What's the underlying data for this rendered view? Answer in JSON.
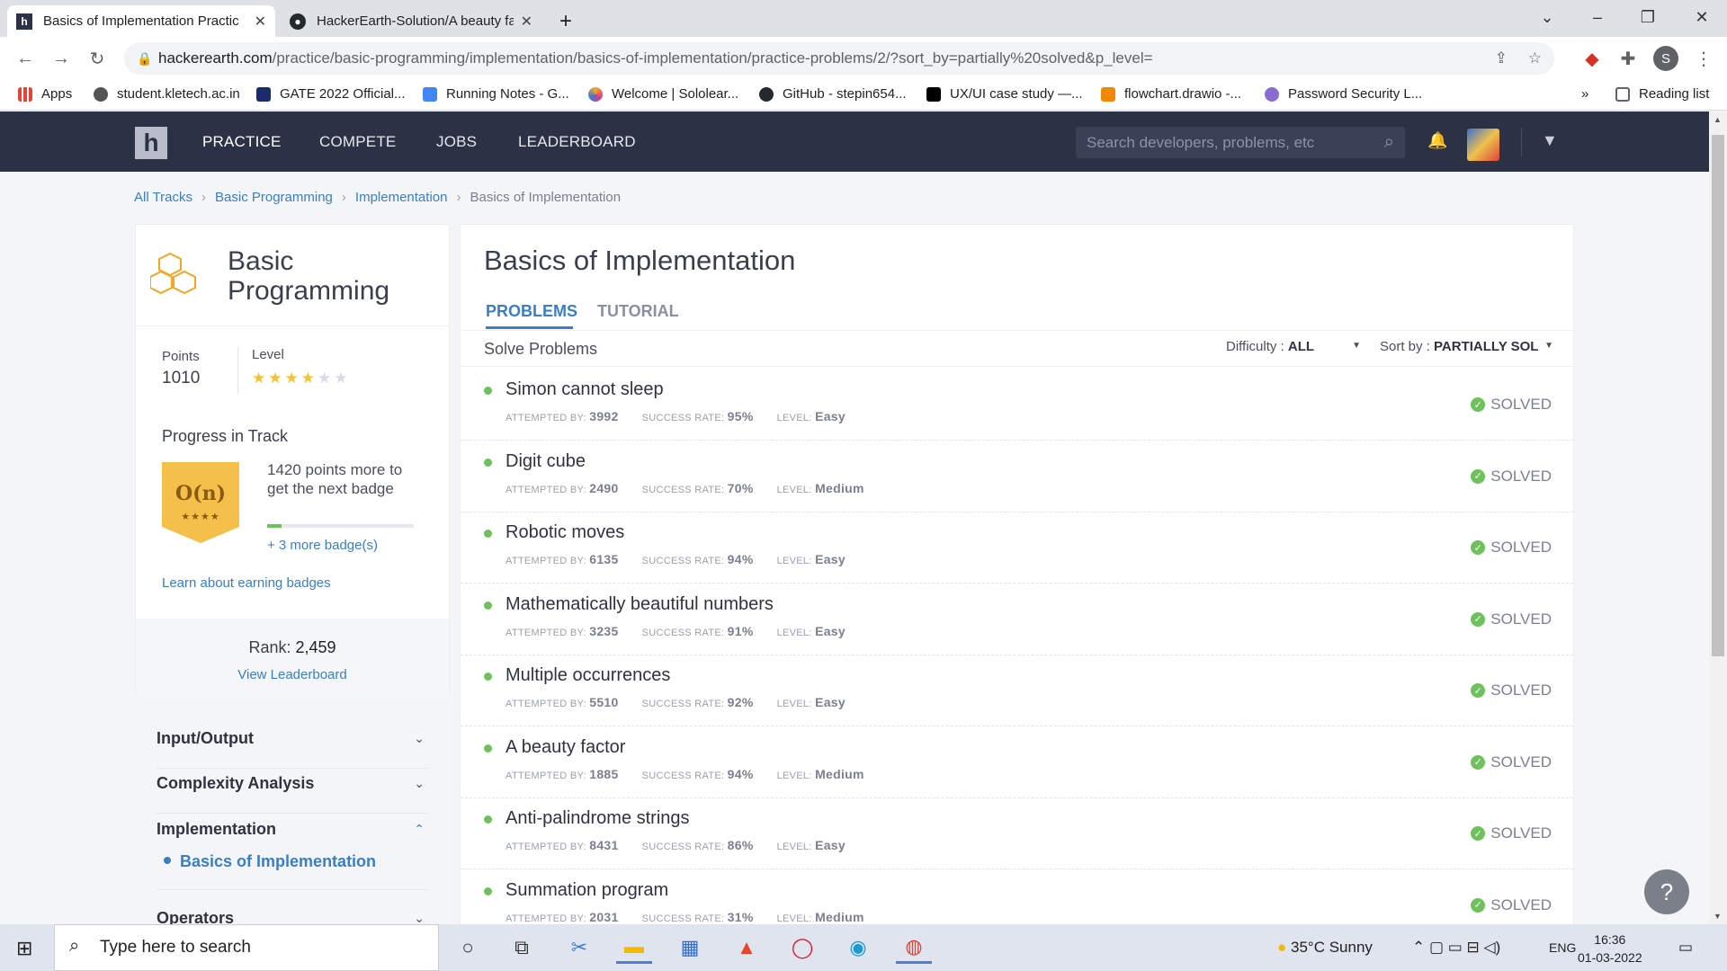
{
  "browser": {
    "tabs": [
      {
        "title": "Basics of Implementation Practic",
        "icon": "hackerearth-icon",
        "active": true
      },
      {
        "title": "HackerEarth-Solution/A beauty fa",
        "icon": "github-icon",
        "active": false
      }
    ],
    "new_tab": "+",
    "url_domain": "hackerearth.com",
    "url_path": "/practice/basic-programming/implementation/basics-of-implementation/practice-problems/2/?sort_by=partially%20solved&p_level=",
    "profile_initial": "S",
    "bookmarks": [
      {
        "label": "Apps",
        "icon": "apps-grid-icon"
      },
      {
        "label": "student.kletech.ac.in",
        "icon": "globe-icon"
      },
      {
        "label": "GATE 2022 Official...",
        "icon": "gate-icon"
      },
      {
        "label": "Running Notes - G...",
        "icon": "docs-icon"
      },
      {
        "label": "Welcome | Sololear...",
        "icon": "sololearn-icon"
      },
      {
        "label": "GitHub - stepin654...",
        "icon": "github-icon"
      },
      {
        "label": "UX/UI case study —...",
        "icon": "medium-icon"
      },
      {
        "label": "flowchart.drawio -...",
        "icon": "drawio-icon"
      },
      {
        "label": "Password Security L...",
        "icon": "spark-icon"
      }
    ],
    "more_bookmarks": "»",
    "reading_list": "Reading list"
  },
  "site_nav": {
    "logo": "h",
    "links": [
      "PRACTICE",
      "COMPETE",
      "JOBS",
      "LEADERBOARD"
    ],
    "search_placeholder": "Search developers, problems, etc"
  },
  "breadcrumb": {
    "items": [
      "All Tracks",
      "Basic Programming",
      "Implementation"
    ],
    "current": "Basics of Implementation",
    "sep": "›"
  },
  "track_card": {
    "title_line1": "Basic",
    "title_line2": "Programming",
    "points_label": "Points",
    "points_value": "1010",
    "level_label": "Level",
    "level_stars": 4,
    "level_max": 6,
    "progress_title": "Progress in Track",
    "badge_text": "O(n)",
    "badge_stars": "★★★★",
    "more_points": "1420 points more to get the next badge",
    "progress_fraction": 0.1,
    "more_badges": "+ 3 more badge(s)",
    "learn_link": "Learn about earning badges",
    "rank_label": "Rank:",
    "rank_value": "2,459",
    "leaderboard_link": "View Leaderboard"
  },
  "side_menu": {
    "items": [
      "Input/Output",
      "Complexity Analysis",
      "Implementation",
      "Operators"
    ],
    "active_sub": "Basics of Implementation"
  },
  "main": {
    "title": "Basics of Implementation",
    "tabs": [
      "PROBLEMS",
      "TUTORIAL"
    ],
    "solve_label": "Solve Problems",
    "difficulty_label": "Difficulty :",
    "difficulty_value": "ALL",
    "sort_label": "Sort by :",
    "sort_value": "PARTIALLY SOL",
    "meta_labels": {
      "attempted": "ATTEMPTED BY:",
      "success": "SUCCESS RATE:",
      "level": "LEVEL:"
    },
    "problems": [
      {
        "name": "Simon cannot sleep",
        "attempted": "3992",
        "success": "95%",
        "level": "Easy",
        "status": "SOLVED"
      },
      {
        "name": "Digit cube",
        "attempted": "2490",
        "success": "70%",
        "level": "Medium",
        "status": "SOLVED"
      },
      {
        "name": "Robotic moves",
        "attempted": "6135",
        "success": "94%",
        "level": "Easy",
        "status": "SOLVED"
      },
      {
        "name": "Mathematically beautiful numbers",
        "attempted": "3235",
        "success": "91%",
        "level": "Easy",
        "status": "SOLVED"
      },
      {
        "name": "Multiple occurrences",
        "attempted": "5510",
        "success": "92%",
        "level": "Easy",
        "status": "SOLVED"
      },
      {
        "name": "A beauty factor",
        "attempted": "1885",
        "success": "94%",
        "level": "Medium",
        "status": "SOLVED"
      },
      {
        "name": "Anti-palindrome strings",
        "attempted": "8431",
        "success": "86%",
        "level": "Easy",
        "status": "SOLVED"
      },
      {
        "name": "Summation program",
        "attempted": "2031",
        "success": "31%",
        "level": "Medium",
        "status": "SOLVED"
      }
    ]
  },
  "taskbar": {
    "search_placeholder": "Type here to search",
    "weather": "35°C  Sunny",
    "lang": "ENG",
    "time": "16:36",
    "date": "01-03-2022"
  },
  "colors": {
    "accent": "#3b7ec6",
    "nav_bg": "#2b3246",
    "success": "#6fc15b",
    "badge": "#f5c04a"
  }
}
